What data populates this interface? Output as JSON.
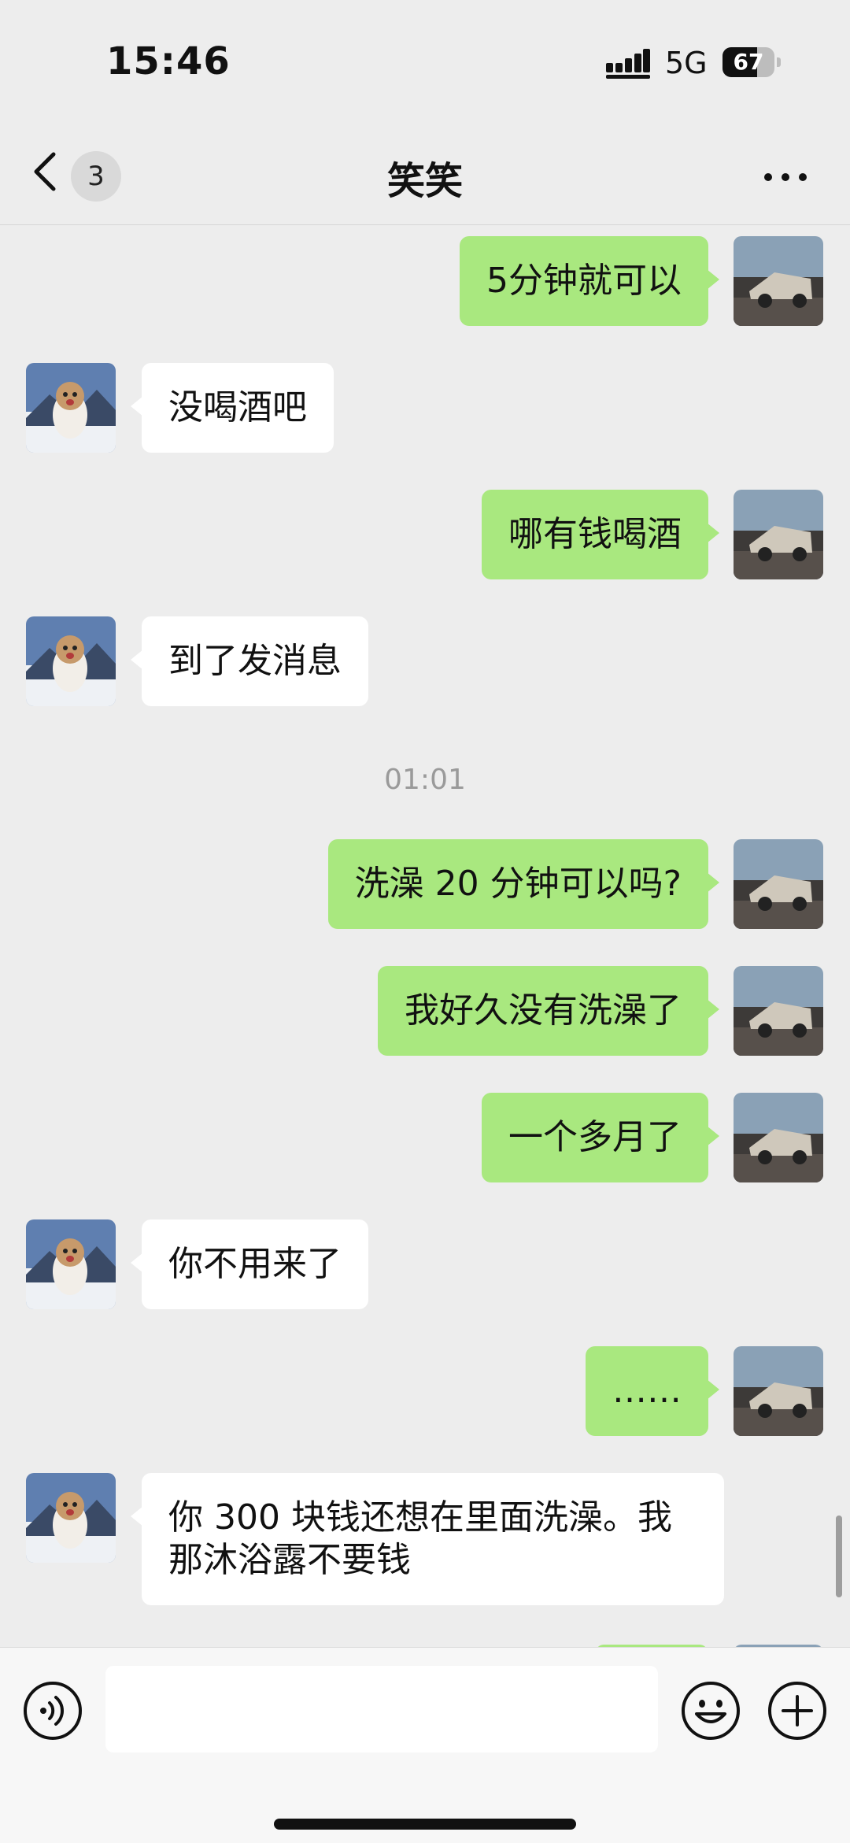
{
  "status_bar": {
    "time": "15:46",
    "network": "5G",
    "battery": "67",
    "battery_level_percent": 67
  },
  "nav": {
    "back_badge": "3",
    "title": "笑笑",
    "more_icon": "more-dots-icon"
  },
  "messages": [
    {
      "sender": "me",
      "text": "5分钟就可以"
    },
    {
      "sender": "them",
      "text": "没喝酒吧"
    },
    {
      "sender": "me",
      "text": "哪有钱喝酒"
    },
    {
      "sender": "them",
      "text": "到了发消息"
    },
    {
      "type": "time",
      "text": "01:01"
    },
    {
      "sender": "me",
      "text": "洗澡 20 分钟可以吗?"
    },
    {
      "sender": "me",
      "text": "我好久没有洗澡了"
    },
    {
      "sender": "me",
      "text": "一个多月了"
    },
    {
      "sender": "them",
      "text": "你不用来了"
    },
    {
      "sender": "me",
      "text": "……"
    },
    {
      "sender": "them",
      "text": "你 300 块钱还想在里面洗澡。我那沐浴露不要钱"
    }
  ],
  "input_bar": {
    "placeholder": "",
    "voice_icon": "voice-icon",
    "emoji_icon": "emoji-icon",
    "plus_icon": "plus-icon"
  },
  "colors": {
    "background": "#ededed",
    "my_bubble": "#a9e87f",
    "their_bubble": "#ffffff"
  }
}
